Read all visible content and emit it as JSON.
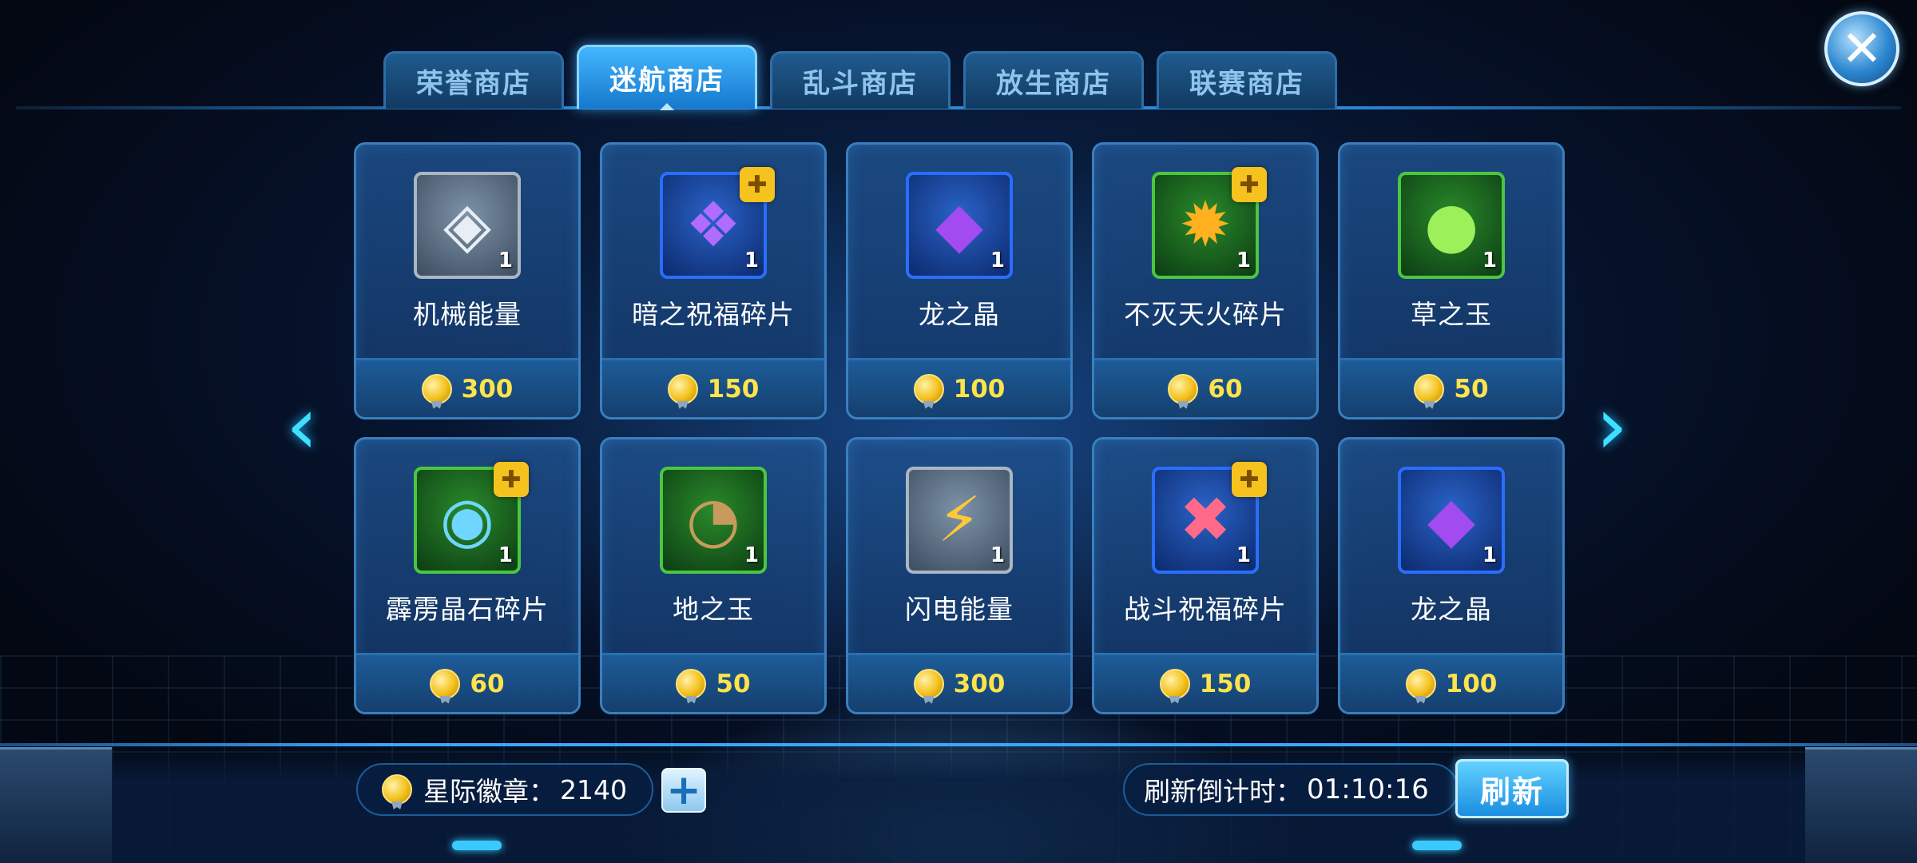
{
  "tabs": [
    {
      "label": "荣誉商店",
      "active": false
    },
    {
      "label": "迷航商店",
      "active": true
    },
    {
      "label": "乱斗商店",
      "active": false
    },
    {
      "label": "放生商店",
      "active": false
    },
    {
      "label": "联赛商店",
      "active": false
    }
  ],
  "close_icon": "close-icon",
  "items": [
    {
      "name": "机械能量",
      "price": "300",
      "qty": "1",
      "rarity": "gray",
      "icon": "mech-energy-icon"
    },
    {
      "name": "暗之祝福碎片",
      "price": "150",
      "qty": "1",
      "rarity": "blue",
      "icon": "dark-blessing-shard-icon",
      "shard": true
    },
    {
      "name": "龙之晶",
      "price": "100",
      "qty": "1",
      "rarity": "blue",
      "icon": "dragon-crystal-icon"
    },
    {
      "name": "不灭天火碎片",
      "price": "60",
      "qty": "1",
      "rarity": "green",
      "icon": "eternal-fire-shard-icon",
      "shard": true
    },
    {
      "name": "草之玉",
      "price": "50",
      "qty": "1",
      "rarity": "green",
      "icon": "grass-jade-icon"
    },
    {
      "name": "霹雳晶石碎片",
      "price": "60",
      "qty": "1",
      "rarity": "green",
      "icon": "thunder-crystal-shard-icon",
      "shard": true
    },
    {
      "name": "地之玉",
      "price": "50",
      "qty": "1",
      "rarity": "green",
      "icon": "earth-jade-icon"
    },
    {
      "name": "闪电能量",
      "price": "300",
      "qty": "1",
      "rarity": "gray",
      "icon": "lightning-energy-icon"
    },
    {
      "name": "战斗祝福碎片",
      "price": "150",
      "qty": "1",
      "rarity": "blue",
      "icon": "battle-blessing-shard-icon",
      "shard": true
    },
    {
      "name": "龙之晶",
      "price": "100",
      "qty": "1",
      "rarity": "blue",
      "icon": "dragon-crystal-icon"
    }
  ],
  "currency": {
    "label": "星际徽章：",
    "value": "2140"
  },
  "timer": {
    "label": "刷新倒计时：",
    "value": "01:10:16"
  },
  "refresh_label": "刷新",
  "colors": {
    "accent": "#3ee0ff",
    "price": "#ffe34a",
    "active_tab": "#43b6ff"
  }
}
